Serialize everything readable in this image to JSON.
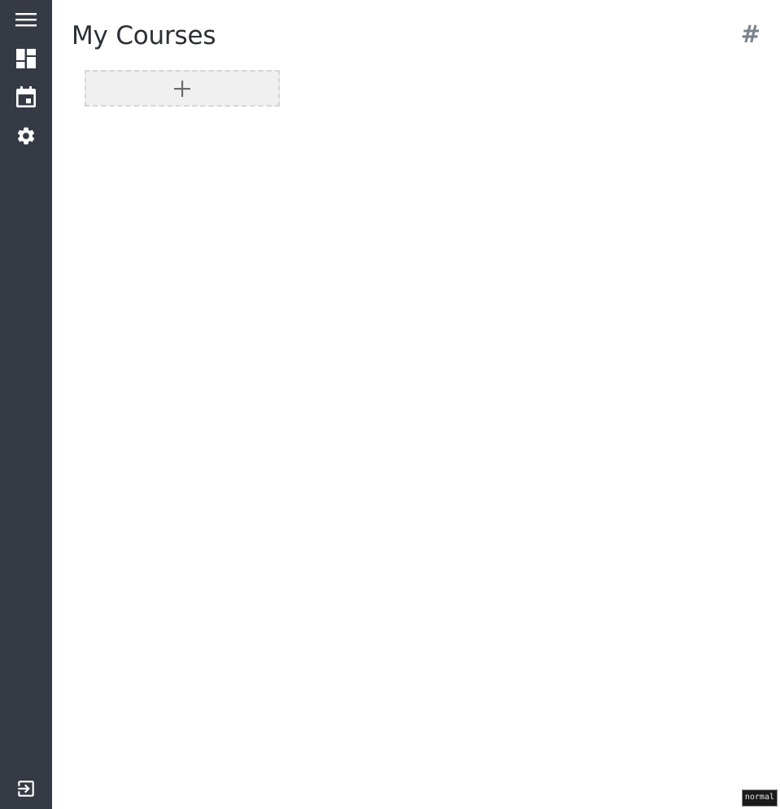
{
  "page": {
    "title": "My Courses",
    "hash_link": "#"
  },
  "sidebar": {
    "items": [
      {
        "icon": "menu-icon"
      },
      {
        "icon": "dashboard-icon"
      },
      {
        "icon": "calendar-icon"
      },
      {
        "icon": "gear-icon"
      }
    ],
    "bottom_icon": "logout-icon"
  },
  "courses": {
    "add_icon": "plus-icon"
  },
  "status": {
    "mode": "normal"
  },
  "colors": {
    "sidebar_bg": "#353a44",
    "icon": "#ffffff",
    "title": "#2b2f35",
    "hash": "#7a828d",
    "add_tile_bg": "#f0f0f0",
    "add_tile_border": "#d4d4d4"
  }
}
